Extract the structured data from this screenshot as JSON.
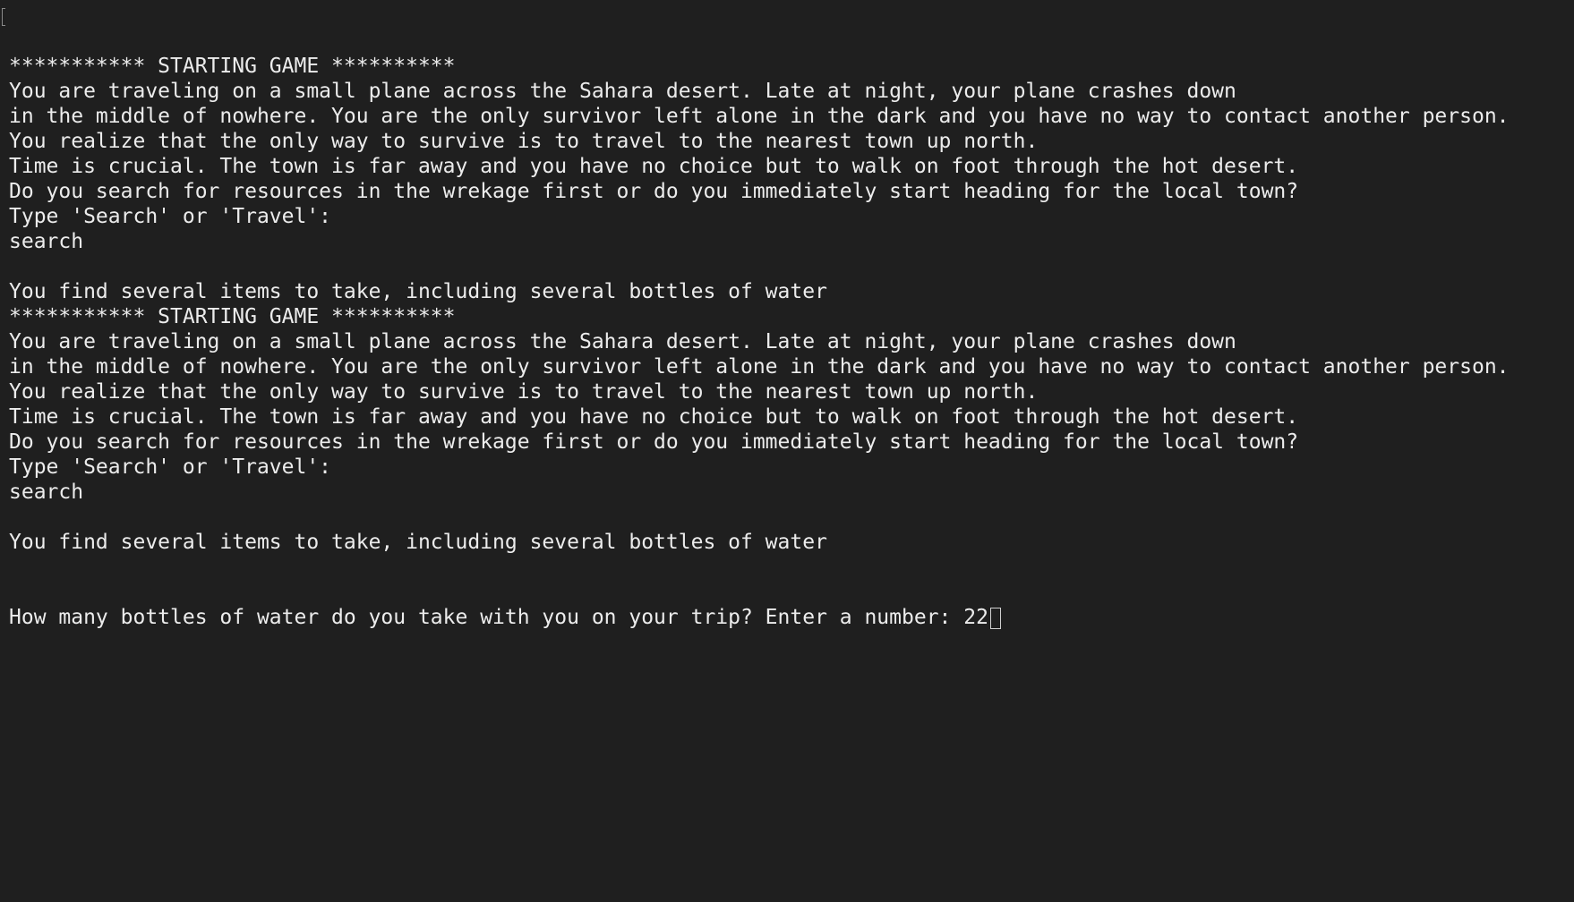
{
  "terminal": {
    "lines": [
      "*********** STARTING GAME **********",
      "You are traveling on a small plane across the Sahara desert. Late at night, your plane crashes down",
      "in the middle of nowhere. You are the only survivor left alone in the dark and you have no way to contact another person.",
      "You realize that the only way to survive is to travel to the nearest town up north.",
      "Time is crucial. The town is far away and you have no choice but to walk on foot through the hot desert.",
      "Do you search for resources in the wrekage first or do you immediately start heading for the local town?",
      "Type 'Search' or 'Travel':",
      "search",
      "",
      "You find several items to take, including several bottles of water",
      "*********** STARTING GAME **********",
      "You are traveling on a small plane across the Sahara desert. Late at night, your plane crashes down",
      "in the middle of nowhere. You are the only survivor left alone in the dark and you have no way to contact another person.",
      "You realize that the only way to survive is to travel to the nearest town up north.",
      "Time is crucial. The town is far away and you have no choice but to walk on foot through the hot desert.",
      "Do you search for resources in the wrekage first or do you immediately start heading for the local town?",
      "Type 'Search' or 'Travel':",
      "search",
      "",
      "You find several items to take, including several bottles of water"
    ],
    "prompt": {
      "text": "How many bottles of water do you take with you on your trip? Enter a number: ",
      "input_value": "22"
    },
    "colors": {
      "background": "#1f1f1f",
      "foreground": "#ececec"
    }
  }
}
